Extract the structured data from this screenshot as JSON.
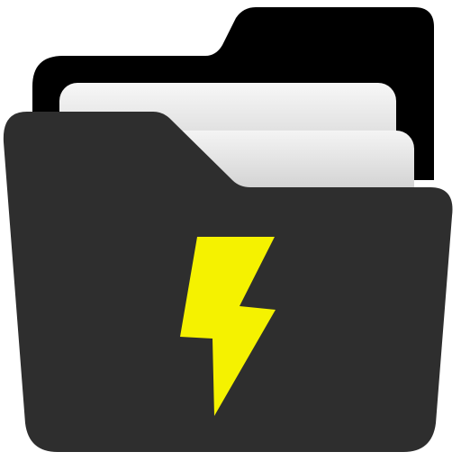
{
  "icon": {
    "name": "folder-lightning-icon",
    "colors": {
      "background": "#ffffff",
      "folder_back": "#000000",
      "folder_front": "#2e2e2e",
      "paper_light": "#f4f4f4",
      "paper_shade": "#bdbdbd",
      "bolt": "#f5f200"
    }
  }
}
